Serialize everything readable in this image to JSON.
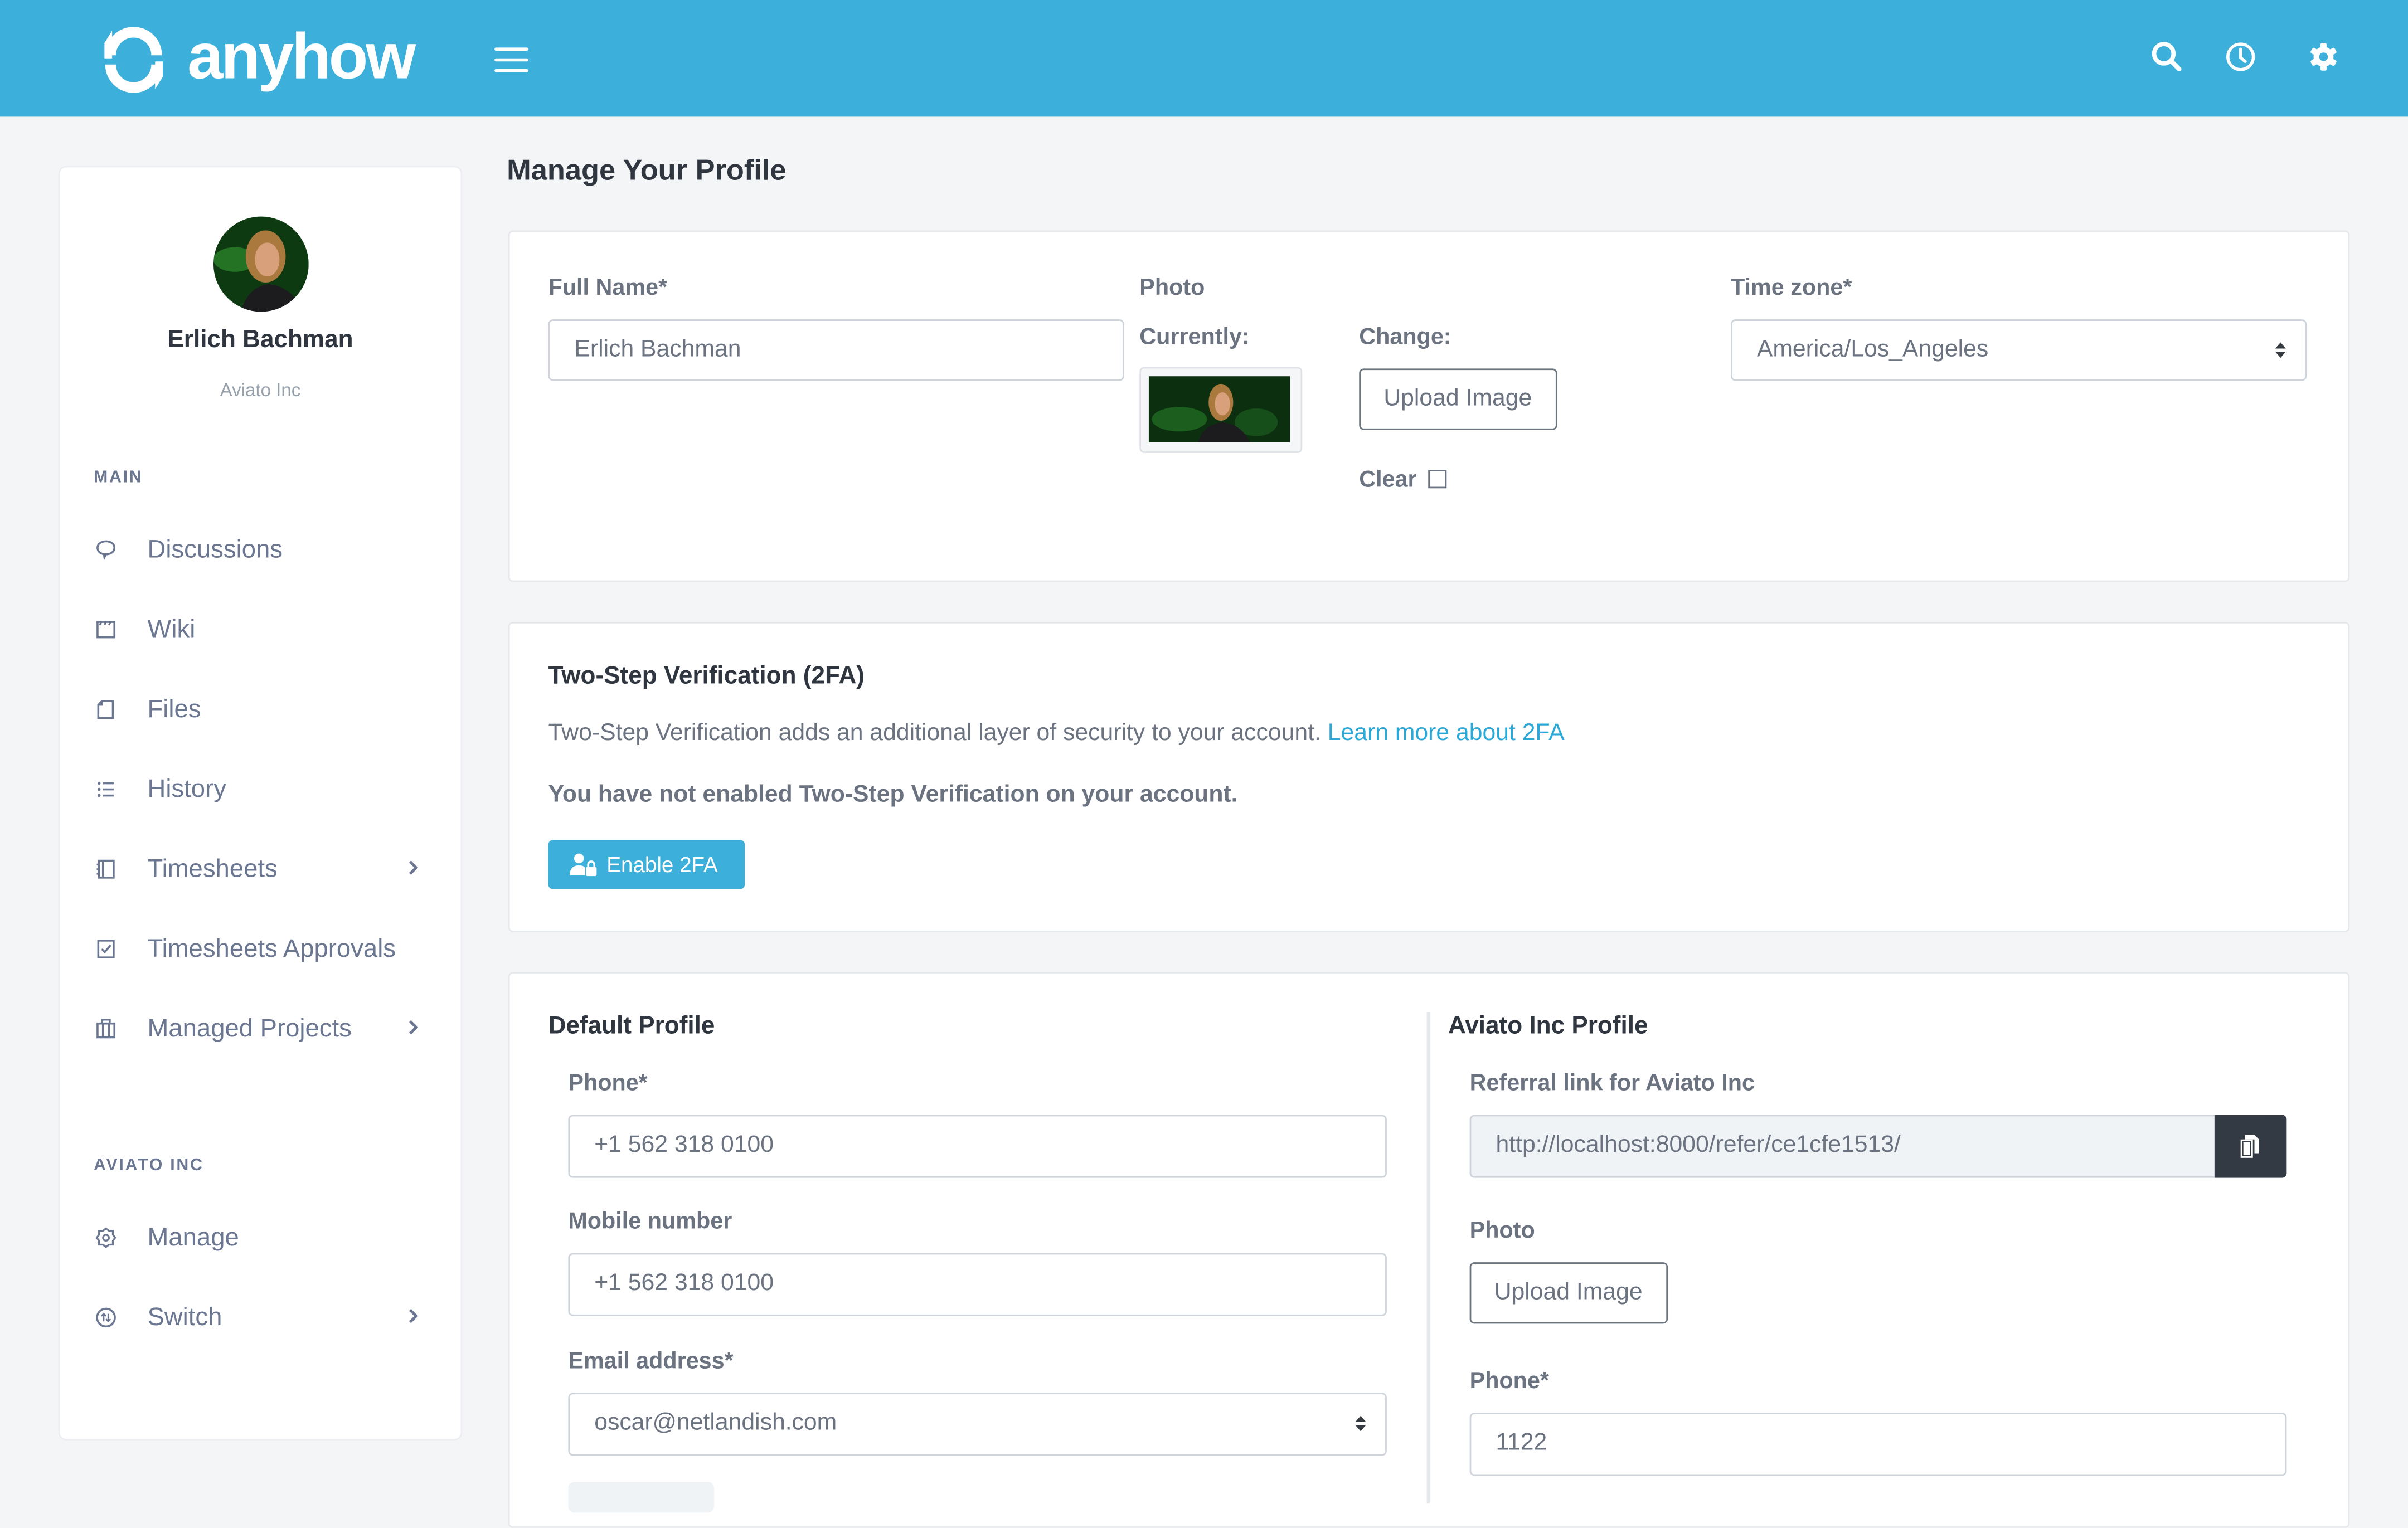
{
  "app": {
    "brand": "anyhow",
    "brand_color": "#3dafdb"
  },
  "header": {
    "menu_icon": "hamburger-icon",
    "actions": [
      {
        "icon": "search-icon",
        "label": "Search"
      },
      {
        "icon": "clock-icon",
        "label": "History"
      },
      {
        "icon": "gear-icon",
        "label": "Settings"
      }
    ]
  },
  "sidebar": {
    "user": {
      "name": "Erlich Bachman",
      "org": "Aviato Inc"
    },
    "sections": [
      {
        "label": "MAIN",
        "items": [
          {
            "label": "Discussions",
            "icon": "speech-bubble-icon",
            "has_submenu": false
          },
          {
            "label": "Wiki",
            "icon": "clapperboard-icon",
            "has_submenu": false
          },
          {
            "label": "Files",
            "icon": "file-icon",
            "has_submenu": false
          },
          {
            "label": "History",
            "icon": "list-icon",
            "has_submenu": false
          },
          {
            "label": "Timesheets",
            "icon": "notebook-icon",
            "has_submenu": true
          },
          {
            "label": "Timesheets Approvals",
            "icon": "checkbox-icon",
            "has_submenu": false
          },
          {
            "label": "Managed Projects",
            "icon": "briefcase-icon",
            "has_submenu": true
          }
        ]
      },
      {
        "label": "AVIATO INC",
        "items": [
          {
            "label": "Manage",
            "icon": "cog-icon",
            "has_submenu": false
          },
          {
            "label": "Switch",
            "icon": "switch-arrows-icon",
            "has_submenu": true
          }
        ]
      }
    ]
  },
  "main": {
    "title": "Manage Your Profile",
    "profile_card": {
      "full_name_label": "Full Name*",
      "full_name_value": "Erlich Bachman",
      "photo_label": "Photo",
      "currently_label": "Currently:",
      "change_label": "Change:",
      "upload_button": "Upload Image",
      "clear_label": "Clear",
      "clear_checked": false,
      "timezone_label": "Time zone*",
      "timezone_value": "America/Los_Angeles"
    },
    "twofa_card": {
      "title": "Two-Step Verification (2FA)",
      "description": "Two-Step Verification adds an additional layer of security to your account.",
      "learn_more_link": "Learn more about 2FA",
      "status": "You have not enabled Two-Step Verification on your account.",
      "enable_button": "Enable 2FA"
    },
    "profiles_card": {
      "default_profile": {
        "title": "Default Profile",
        "phone_label": "Phone*",
        "phone_value": "+1 562 318 0100",
        "mobile_label": "Mobile number",
        "mobile_value": "+1 562 318 0100",
        "email_label": "Email address*",
        "email_value": "oscar@netlandish.com"
      },
      "org_profile": {
        "title": "Aviato Inc Profile",
        "referral_label": "Referral link for Aviato Inc",
        "referral_value": "http://localhost:8000/refer/ce1cfe1513/",
        "photo_label": "Photo",
        "upload_button": "Upload Image",
        "phone_label": "Phone*",
        "phone_value": "1122"
      }
    }
  }
}
